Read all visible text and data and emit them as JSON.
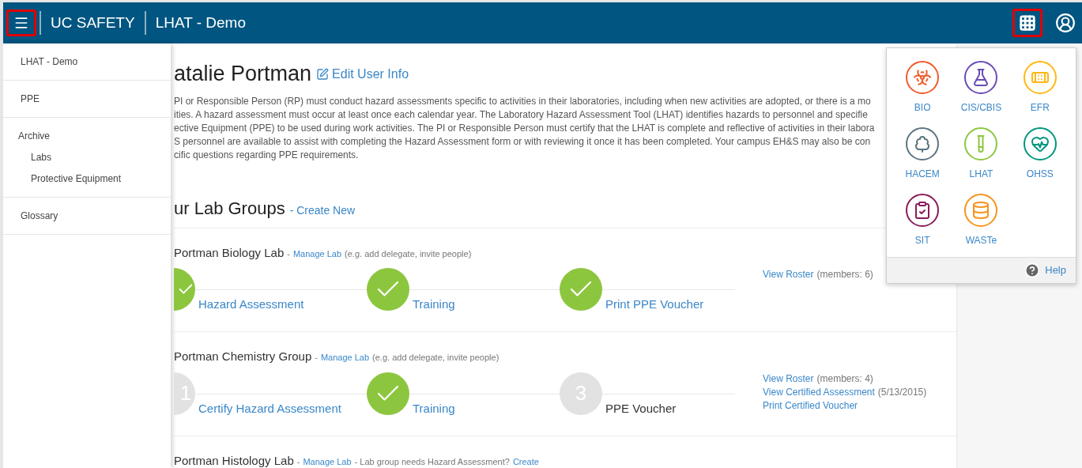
{
  "header": {
    "brand": "UC SAFETY",
    "app_title": "LHAT - Demo",
    "menu_highlighted": true,
    "apps_highlighted": true
  },
  "sidebar": {
    "items": [
      {
        "label": "LHAT - Demo"
      },
      {
        "label": "PPE"
      },
      {
        "label": "Archive",
        "children": [
          {
            "label": "Labs"
          },
          {
            "label": "Protective Equipment"
          }
        ]
      },
      {
        "label": "Glossary"
      }
    ]
  },
  "profile": {
    "name": "atalie Portman",
    "edit_link": "Edit User Info"
  },
  "intro_lines": [
    "PI or Responsible Person (RP) must conduct hazard assessments specific to activities in their laboratories, including when new activities are adopted, or there is a mo",
    "ities. A hazard assessment must occur at least once each calendar year. The Laboratory Hazard Assessment Tool (LHAT) identifies hazards to personnel and specifie",
    "ective Equipment (PPE) to be used during work activities. The PI or Responsible Person must certify that the LHAT is complete and reflective of activities in their labora",
    "S personnel are available to assist with completing the Hazard Assessment form or with reviewing it once it has been completed. Your campus EH&S may also be con",
    "cific questions regarding PPE requirements."
  ],
  "lab_groups": {
    "title": "ur Lab Groups",
    "create_link": "- Create New",
    "labs": [
      {
        "name": "Portman Biology Lab",
        "meta": [
          {
            "kind": "note",
            "text": "-"
          },
          {
            "kind": "link",
            "text": "Manage Lab"
          },
          {
            "kind": "note",
            "text": "(e.g. add delegate, invite people)"
          }
        ],
        "steps": [
          {
            "kind": "done",
            "label": "Hazard Assessment",
            "link": true
          },
          {
            "kind": "done",
            "label": "Training",
            "link": true
          },
          {
            "kind": "done",
            "label": "Print PPE Voucher",
            "link": true
          }
        ],
        "side_links": [
          [
            {
              "kind": "link",
              "text": "View Roster"
            },
            {
              "kind": "note",
              "text": "(members: 6)"
            }
          ]
        ]
      },
      {
        "name": "Portman Chemistry Group",
        "meta": [
          {
            "kind": "note",
            "text": "-"
          },
          {
            "kind": "link",
            "text": "Manage Lab"
          },
          {
            "kind": "note",
            "text": "(e.g. add delegate, invite people)"
          }
        ],
        "steps": [
          {
            "kind": "pending",
            "number": "1",
            "label": "Certify Hazard Assessment",
            "link": true
          },
          {
            "kind": "done",
            "label": "Training",
            "link": true
          },
          {
            "kind": "pending",
            "number": "3",
            "label": "PPE Voucher",
            "link": false
          }
        ],
        "side_links": [
          [
            {
              "kind": "link",
              "text": "View Roster"
            },
            {
              "kind": "note",
              "text": "(members: 4)"
            }
          ],
          [
            {
              "kind": "link",
              "text": "View Certified Assessment"
            },
            {
              "kind": "note",
              "text": "(5/13/2015)"
            }
          ],
          [
            {
              "kind": "link",
              "text": "Print Certified Voucher"
            }
          ]
        ]
      },
      {
        "name": "Portman Histology Lab",
        "meta": [
          {
            "kind": "note",
            "text": "-"
          },
          {
            "kind": "link",
            "text": "Manage Lab"
          },
          {
            "kind": "note",
            "text": "- Lab group needs Hazard Assessment?"
          },
          {
            "kind": "link",
            "text": "Create"
          }
        ]
      }
    ]
  },
  "apps_menu": {
    "apps": [
      {
        "label": "BIO",
        "color": "#f15a29"
      },
      {
        "label": "CIS/CBIS",
        "color": "#6a4bb6"
      },
      {
        "label": "EFR",
        "color": "#fdb813"
      },
      {
        "label": "HACEM",
        "color": "#5b7481"
      },
      {
        "label": "LHAT",
        "color": "#8dc63f"
      },
      {
        "label": "OHSS",
        "color": "#00967f"
      },
      {
        "label": "SIT",
        "color": "#8a1c5a"
      },
      {
        "label": "WASTe",
        "color": "#f7941d"
      }
    ],
    "help": "Help"
  }
}
